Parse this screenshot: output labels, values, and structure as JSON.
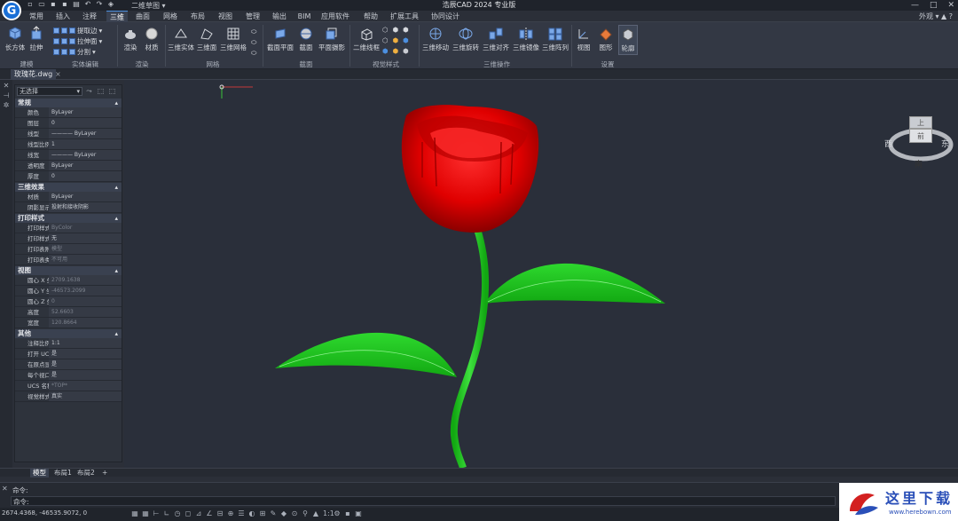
{
  "titlebar": {
    "workspace": "二维草图",
    "title": "浩辰CAD 2024 专业版"
  },
  "menu": {
    "tabs": [
      "常用",
      "插入",
      "注释",
      "三维",
      "曲面",
      "网格",
      "布局",
      "视图",
      "管理",
      "输出",
      "BIM",
      "应用软件",
      "帮助",
      "扩展工具",
      "协同设计"
    ],
    "active": "三维",
    "right_label": "外观"
  },
  "ribbon": {
    "buttons": {
      "box": "长方体",
      "extrude": "拉伸",
      "extract_edges": "提取边",
      "presspull": "拉伸面",
      "slice": "分割",
      "render": "渲染",
      "material": "材质",
      "mesh_solid": "三维实体",
      "mesh_surface": "三维面",
      "mesh_grid": "三维网格",
      "section_plane": "截面平面",
      "section": "截面",
      "flatshot": "平面摄影",
      "wireframe_2d": "二维线框",
      "move_3d": "三维移动",
      "rotate_3d": "三维旋转",
      "align_3d": "三维对齐",
      "mirror_3d": "三维镜像",
      "array_3d": "三维阵列",
      "view": "视图",
      "graphics": "图形",
      "outline": "轮廓"
    },
    "groups": {
      "modeling": "建模",
      "solid_edit": "实体编辑",
      "render": "渲染",
      "mesh": "网格",
      "section": "截面",
      "visual_style": "视觉样式",
      "ops_3d": "三维操作",
      "settings": "设置"
    }
  },
  "document": {
    "tab": "玫瑰花.dwg"
  },
  "properties": {
    "selection": "无选择",
    "sections": [
      {
        "title": "常规",
        "rows": [
          {
            "k": "颜色",
            "v": "ByLayer"
          },
          {
            "k": "图层",
            "v": "0"
          },
          {
            "k": "线型",
            "v": "———— ByLayer"
          },
          {
            "k": "线型比例",
            "v": "1"
          },
          {
            "k": "线宽",
            "v": "———— ByLayer"
          },
          {
            "k": "透明度",
            "v": "ByLayer"
          },
          {
            "k": "厚度",
            "v": "0"
          }
        ]
      },
      {
        "title": "三维效果",
        "rows": [
          {
            "k": "材质",
            "v": "ByLayer"
          },
          {
            "k": "阴影显示",
            "v": "投射和接收阴影"
          }
        ]
      },
      {
        "title": "打印样式",
        "rows": [
          {
            "k": "打印样式",
            "v": "ByColor",
            "dim": true
          },
          {
            "k": "打印样式表",
            "v": "无"
          },
          {
            "k": "打印表附…",
            "v": "模型",
            "dim": true
          },
          {
            "k": "打印表类型",
            "v": "不可用",
            "dim": true
          }
        ]
      },
      {
        "title": "视图",
        "rows": [
          {
            "k": "圆心 X 坐标",
            "v": "2709.1638",
            "dim": true
          },
          {
            "k": "圆心 Y 坐标",
            "v": "-46573.2099",
            "dim": true
          },
          {
            "k": "圆心 Z 坐标",
            "v": "0",
            "dim": true
          },
          {
            "k": "高度",
            "v": "52.6603",
            "dim": true
          },
          {
            "k": "宽度",
            "v": "120.8664",
            "dim": true
          }
        ]
      },
      {
        "title": "其他",
        "rows": [
          {
            "k": "注释比例",
            "v": "1:1"
          },
          {
            "k": "打开 UCS…",
            "v": "是"
          },
          {
            "k": "在原点显…",
            "v": "是"
          },
          {
            "k": "每个视口…",
            "v": "是"
          },
          {
            "k": "UCS 名称",
            "v": "*TOP*",
            "dim": true
          },
          {
            "k": "视觉样式",
            "v": "真实"
          }
        ]
      }
    ]
  },
  "viewcube": {
    "top": "上",
    "front": "前",
    "west": "西",
    "east": "东",
    "south": "南"
  },
  "layout_tabs": [
    "模型",
    "布局1",
    "布局2",
    "+"
  ],
  "command": {
    "line1": "命令:",
    "line2": "命令:"
  },
  "status": {
    "coords": "2674.4368, -46535.9072, 0"
  },
  "watermark": {
    "text": "这里下载",
    "url": "www.herebown.com"
  },
  "colors": {
    "rose": "#e00000",
    "leaf": "#1ec81e",
    "viewport": "#2a2f3a",
    "accent": "#4c8fe0"
  }
}
